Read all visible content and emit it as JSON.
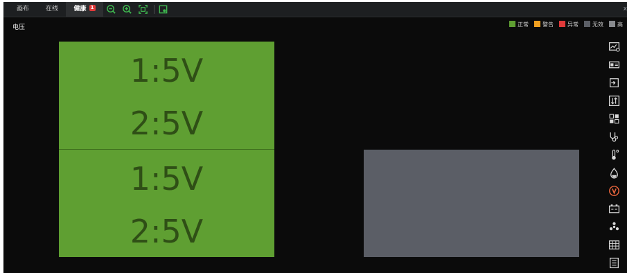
{
  "tabs": [
    {
      "label": "画布",
      "active": false
    },
    {
      "label": "在线",
      "active": false
    },
    {
      "label": "健康",
      "active": true,
      "badge": "1"
    }
  ],
  "toolbar": {
    "icons": [
      "zoom-out-icon",
      "zoom-in-icon",
      "fit-screen-icon",
      "export-icon"
    ],
    "accent_color": "#3fb950"
  },
  "close_glyph": "x",
  "section_title": "电压",
  "legend": [
    {
      "label": "正常",
      "color": "#5f9f32"
    },
    {
      "label": "警告",
      "color": "#f0a020"
    },
    {
      "label": "异常",
      "color": "#e03a3a"
    },
    {
      "label": "无效",
      "color": "#5b5e66"
    },
    {
      "label": "高",
      "color": "#888a8e"
    }
  ],
  "panels": [
    {
      "status": "normal",
      "color": "#5f9f32",
      "cells": [
        {
          "lines": [
            "1:5V",
            "2:5V"
          ]
        },
        {
          "lines": [
            "1:5V",
            "2:5V"
          ]
        }
      ]
    },
    {
      "status": "invalid",
      "color": "#5b5e66",
      "cells": []
    }
  ],
  "rail_icons": [
    "chart-settings-icon",
    "card-icon",
    "login-icon",
    "sort-icon",
    "grid-check-icon",
    "stethoscope-icon",
    "thermometer-icon",
    "water-drop-icon",
    "voltage-icon",
    "battery-icon",
    "fan-icon",
    "matrix-icon",
    "list-icon"
  ],
  "active_rail_icon": "voltage-icon"
}
